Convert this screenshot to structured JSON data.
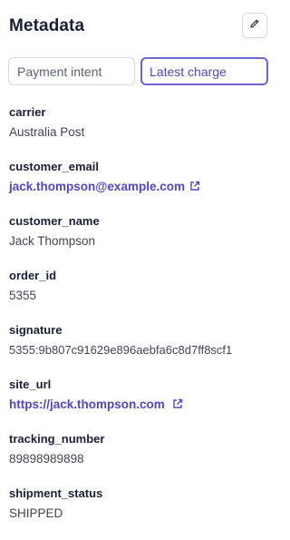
{
  "header": {
    "title": "Metadata",
    "edit_icon": "pencil-icon"
  },
  "tabs": [
    {
      "label": "Payment intent",
      "active": false
    },
    {
      "label": "Latest charge",
      "active": true
    }
  ],
  "fields": [
    {
      "key": "carrier",
      "value": "Australia Post"
    },
    {
      "key": "customer_email",
      "value": "jack.thompson@example.com",
      "link": true
    },
    {
      "key": "customer_name",
      "value": "Jack Thompson"
    },
    {
      "key": "order_id",
      "value": "5355"
    },
    {
      "key": "signature",
      "value": "5355:9b807c91629e896aebfa6c8d7ff8scf1"
    },
    {
      "key": "site_url",
      "value": "https://jack.thompson.com",
      "link": true
    },
    {
      "key": "tracking_number",
      "value": "89898989898"
    },
    {
      "key": "shipment_status",
      "value": "SHIPPED"
    }
  ],
  "colors": {
    "accent": "#5146c8",
    "active_tab_border": "#6e64d8",
    "border": "#d5d9e2",
    "text": "#1a1f36"
  }
}
